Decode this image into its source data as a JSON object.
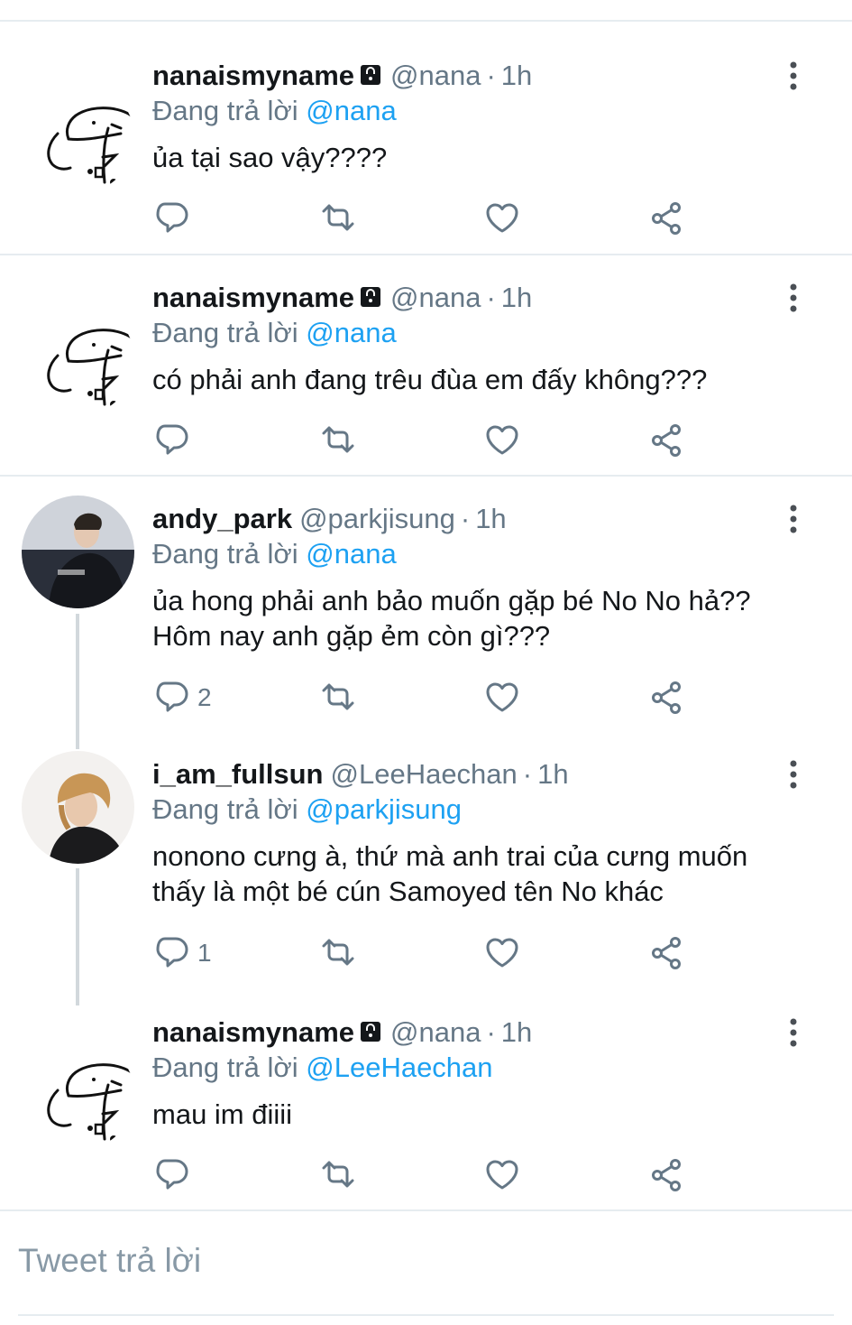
{
  "tweets": [
    {
      "avatar": "doodle-avatar",
      "name": "nanaismyname",
      "locked": true,
      "handle": "@nana",
      "time": "1h",
      "reply_prefix": "Đang trả lời",
      "reply_to": "@nana",
      "lines": [
        "ủa tại sao vậy????"
      ],
      "reply_count": ""
    },
    {
      "avatar": "doodle-avatar",
      "name": "nanaismyname",
      "locked": true,
      "handle": "@nana",
      "time": "1h",
      "reply_prefix": "Đang trả lời",
      "reply_to": "@nana",
      "lines": [
        "có phải anh đang trêu đùa em đấy không???"
      ],
      "reply_count": ""
    },
    {
      "avatar": "photo-avatar-dark-jacket",
      "name": "andy_park",
      "locked": false,
      "handle": "@parkjisung",
      "time": "1h",
      "reply_prefix": "Đang trả lời",
      "reply_to": "@nana",
      "lines": [
        "ủa hong phải anh bảo muốn gặp bé No No hả??",
        "Hôm nay anh gặp ẻm còn gì???"
      ],
      "reply_count": "2"
    },
    {
      "avatar": "photo-avatar-blond-hair",
      "name": "i_am_fullsun",
      "locked": false,
      "handle": "@LeeHaechan",
      "time": "1h",
      "reply_prefix": "Đang trả lời",
      "reply_to": "@parkjisung",
      "lines": [
        "nonono cưng à, thứ mà anh trai của cưng muốn",
        "thấy là một bé cún Samoyed tên No khác"
      ],
      "reply_count": "1"
    },
    {
      "avatar": "doodle-avatar",
      "name": "nanaismyname",
      "locked": true,
      "handle": "@nana",
      "time": "1h",
      "reply_prefix": "Đang trả lời",
      "reply_to": "@LeeHaechan",
      "lines": [
        "mau im điiii"
      ],
      "reply_count": ""
    }
  ],
  "separator": "·",
  "composer": {
    "placeholder": "Tweet trả lời"
  },
  "icons": [
    "reply-icon",
    "retweet-icon",
    "like-icon",
    "share-icon",
    "more-icon",
    "lock-icon"
  ],
  "colors": {
    "text": "#14171a",
    "secondary": "#657786",
    "link": "#1da1f2",
    "divider": "#e6ecf0",
    "thread": "#d2d8dc"
  }
}
